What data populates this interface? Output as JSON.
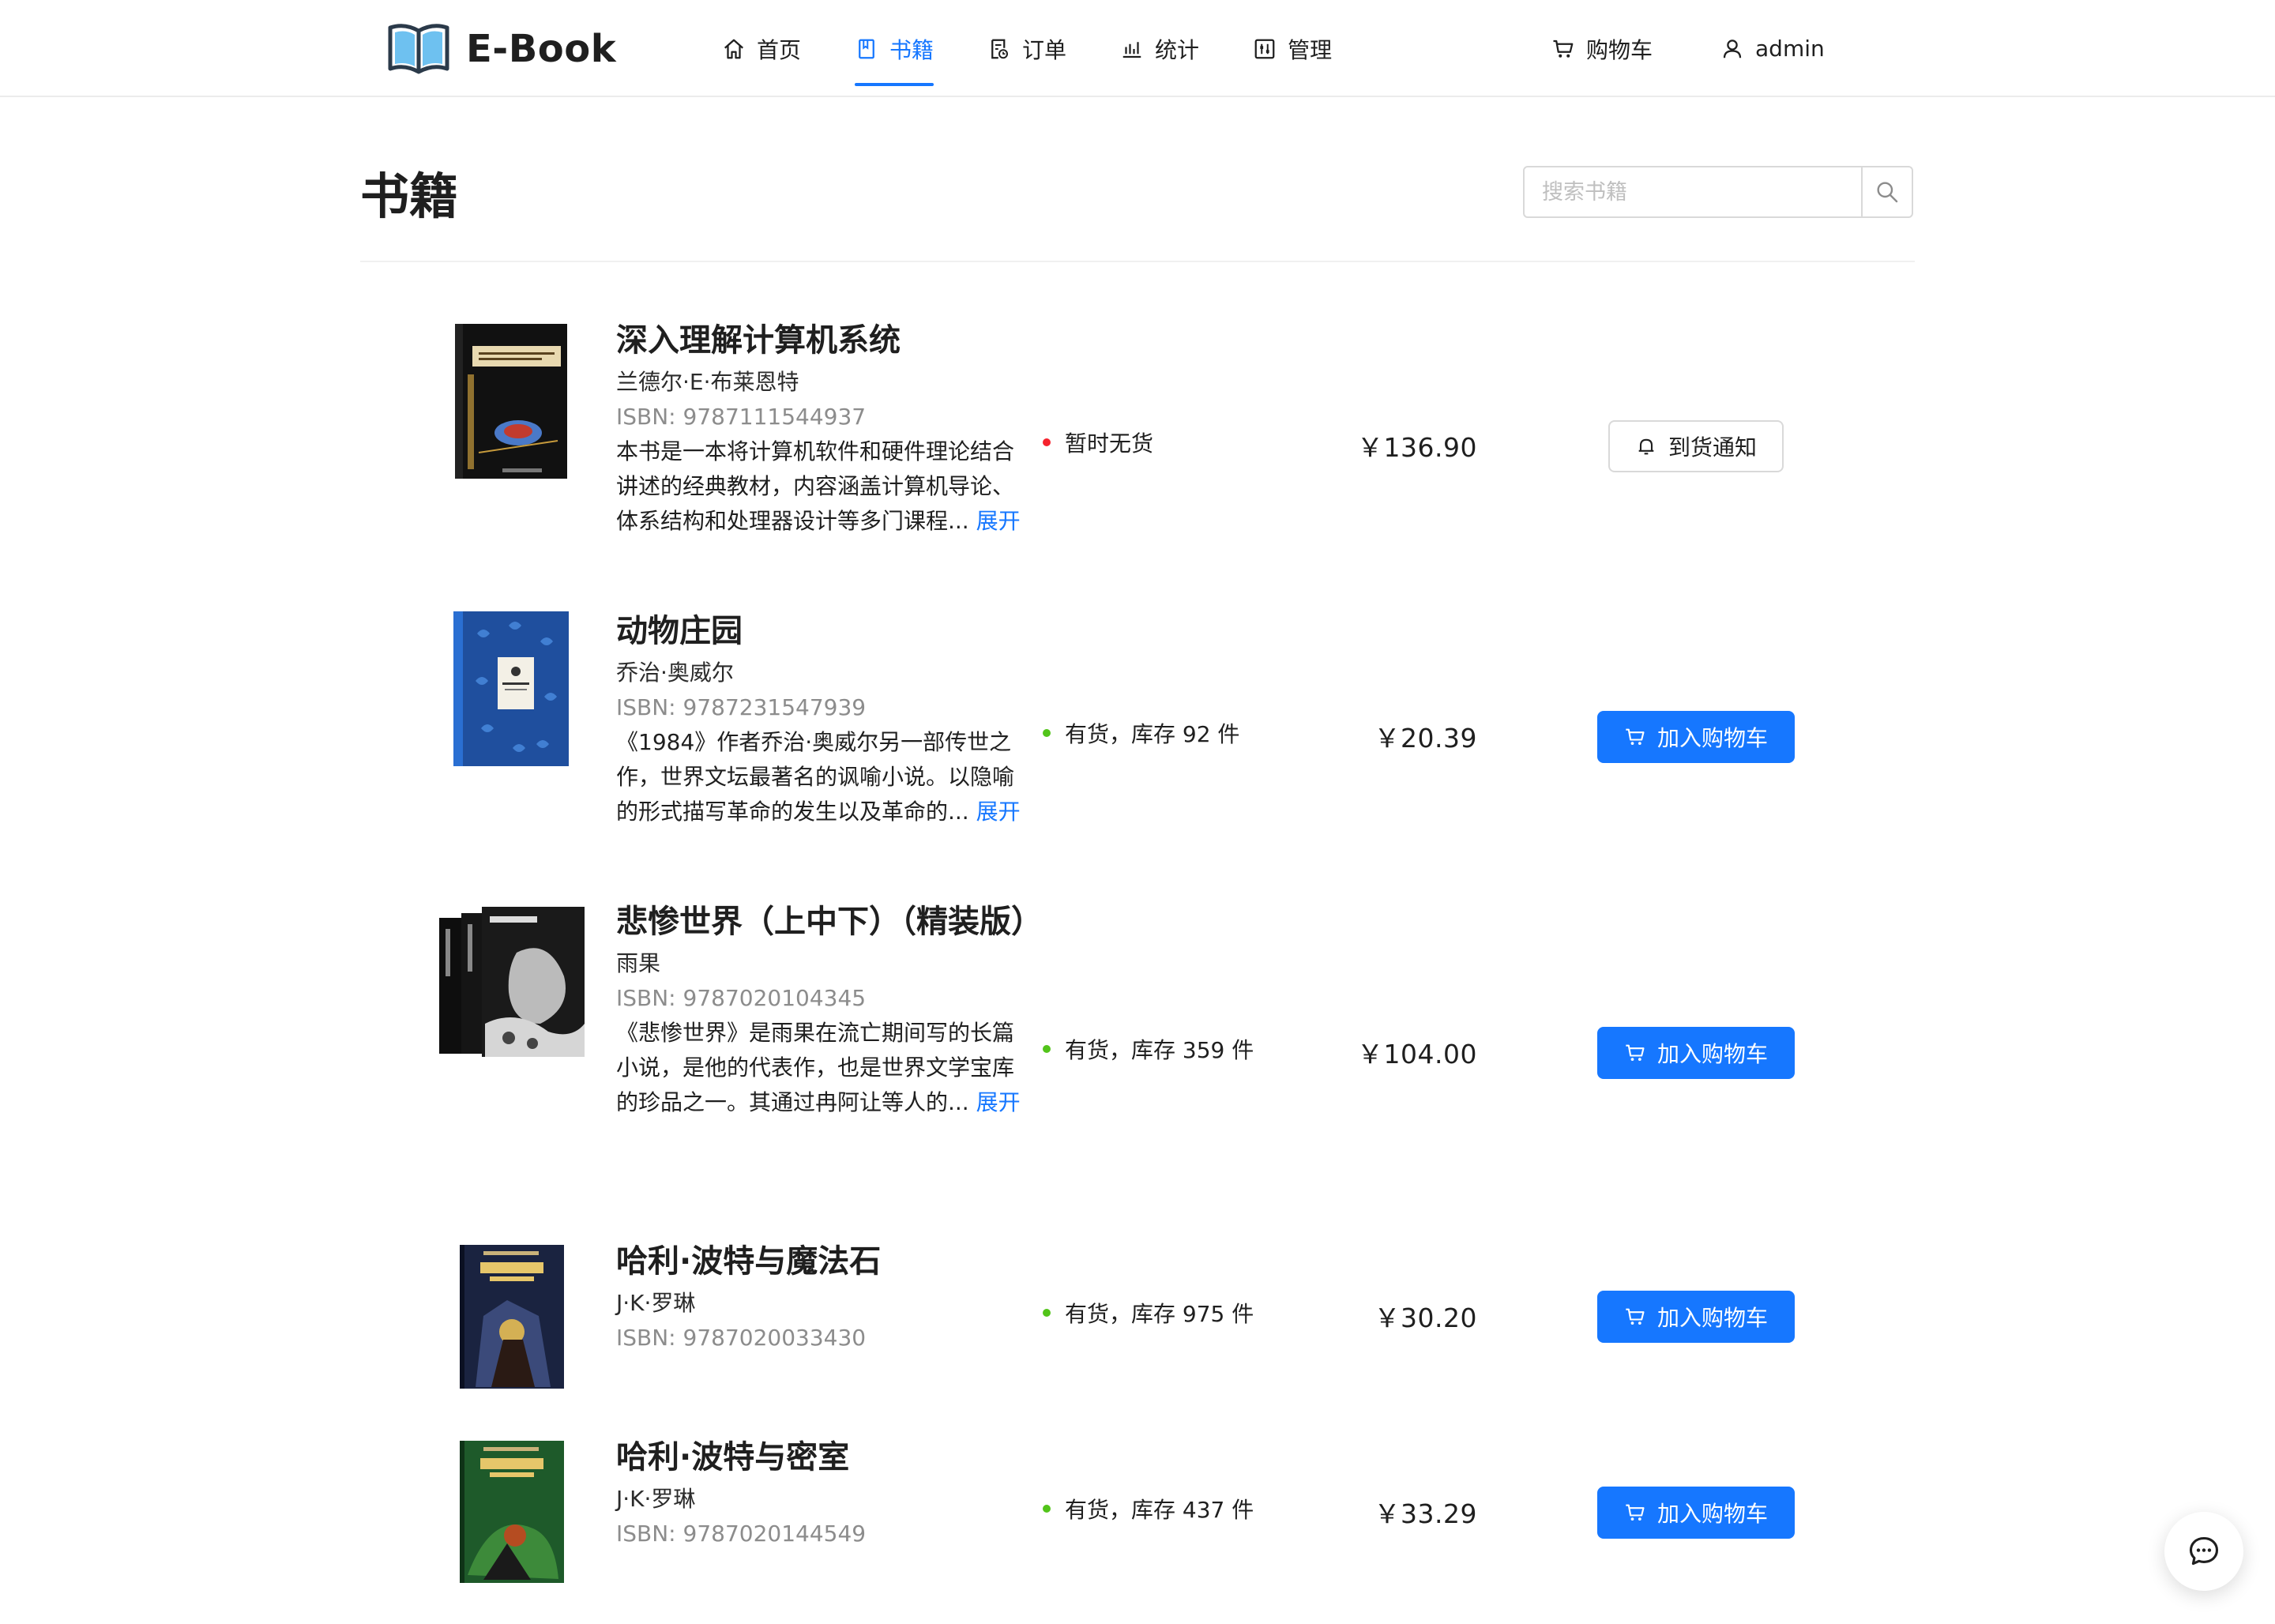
{
  "app": {
    "name": "E-Book",
    "logo_icon": "open-book-icon"
  },
  "nav": {
    "items": [
      {
        "label": "首页",
        "icon": "home-icon",
        "active": false
      },
      {
        "label": "书籍",
        "icon": "book-icon",
        "active": true
      },
      {
        "label": "订单",
        "icon": "order-icon",
        "active": false
      },
      {
        "label": "统计",
        "icon": "chart-icon",
        "active": false
      },
      {
        "label": "管理",
        "icon": "admin-icon",
        "active": false
      }
    ],
    "cart_label": "购物车",
    "user_label": "admin"
  },
  "page": {
    "title": "书籍",
    "search_placeholder": "搜索书籍"
  },
  "colors": {
    "primary": "#1677ff",
    "in_stock": "#52c41a",
    "out_of_stock": "#f5222d"
  },
  "books": [
    {
      "title": "深入理解计算机系统",
      "author": "兰德尔·E·布莱恩特",
      "isbn": "ISBN: 9787111544937",
      "desc": "本书是一本将计算机软件和硬件理论结合讲述的经典教材，内容涵盖计算机导论、体系结构和处理器设计等多门课程...",
      "expand": "展开",
      "stock": "暂时无货",
      "in_stock": false,
      "price": "￥136.90",
      "action": "到货通知"
    },
    {
      "title": "动物庄园",
      "author": "乔治·奥威尔",
      "isbn": "ISBN: 9787231547939",
      "desc": "《1984》作者乔治·奥威尔另一部传世之作，世界文坛最著名的讽喻小说。以隐喻的形式描写革命的发生以及革命的...",
      "expand": "展开",
      "stock": "有货，库存 92 件",
      "in_stock": true,
      "price": "￥20.39",
      "action": "加入购物车"
    },
    {
      "title": "悲惨世界（上中下）（精装版）",
      "author": "雨果",
      "isbn": "ISBN: 9787020104345",
      "desc": "《悲惨世界》是雨果在流亡期间写的长篇小说，是他的代表作，也是世界文学宝库的珍品之一。其通过冉阿让等人的...",
      "expand": "展开",
      "stock": "有货，库存 359 件",
      "in_stock": true,
      "price": "￥104.00",
      "action": "加入购物车"
    },
    {
      "title": "哈利·波特与魔法石",
      "author": "J·K·罗琳",
      "isbn": "ISBN: 9787020033430",
      "stock": "有货，库存 975 件",
      "in_stock": true,
      "price": "￥30.20",
      "action": "加入购物车"
    },
    {
      "title": "哈利·波特与密室",
      "author": "J·K·罗琳",
      "isbn": "ISBN: 9787020144549",
      "stock": "有货，库存 437 件",
      "in_stock": true,
      "price": "￥33.29",
      "action": "加入购物车"
    }
  ],
  "float_button": {
    "icon": "chat-icon"
  }
}
